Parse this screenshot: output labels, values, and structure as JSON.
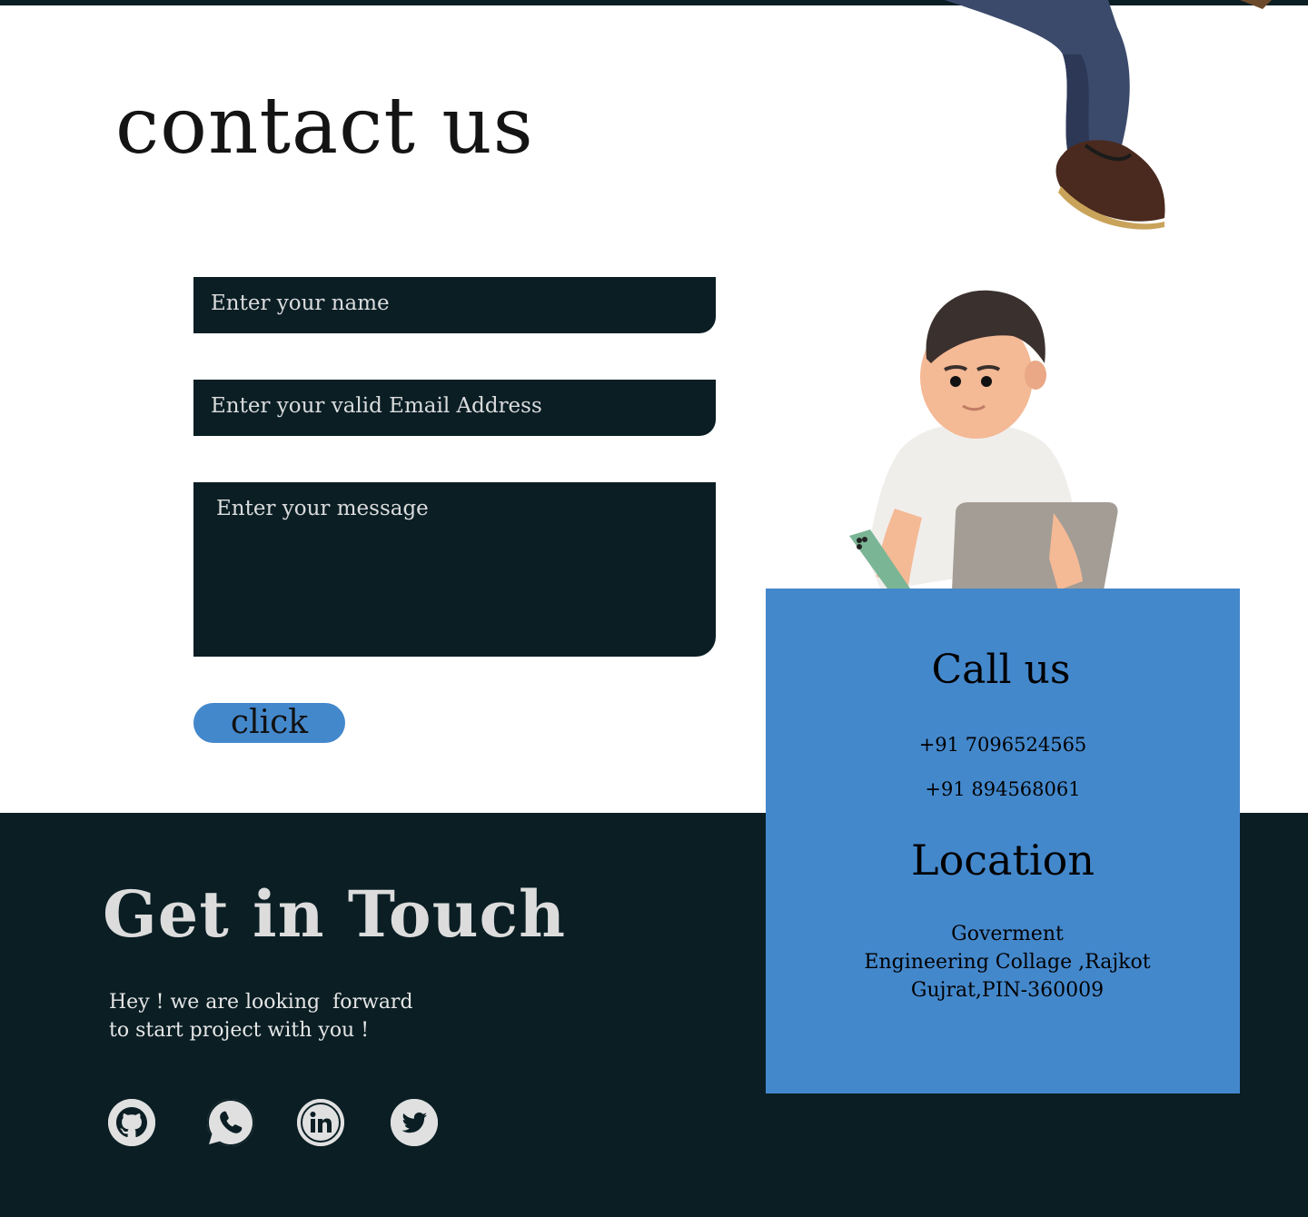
{
  "page": {
    "title": "contact us"
  },
  "form": {
    "name_placeholder": "Enter your name",
    "email_placeholder": "Enter your valid Email Address",
    "message_placeholder": "Enter your message",
    "submit_label": "click"
  },
  "contact_card": {
    "call_heading": "Call us",
    "phones": [
      "+91 7096524565",
      "+91 894568061"
    ],
    "location_heading": "Location",
    "address_lines": [
      "Goverment",
      "Engineering Collage ,Rajkot",
      "Gujrat,PIN-360009"
    ]
  },
  "footer": {
    "heading": "Get in Touch",
    "tagline": "Hey ! we are looking  forward\nto start project with you !",
    "social": [
      {
        "name": "github-icon"
      },
      {
        "name": "whatsapp-icon"
      },
      {
        "name": "linkedin-icon"
      },
      {
        "name": "twitter-icon"
      }
    ]
  },
  "colors": {
    "dark": "#0a1e24",
    "accent": "#4488cc",
    "light_text": "#e6e6e6"
  }
}
